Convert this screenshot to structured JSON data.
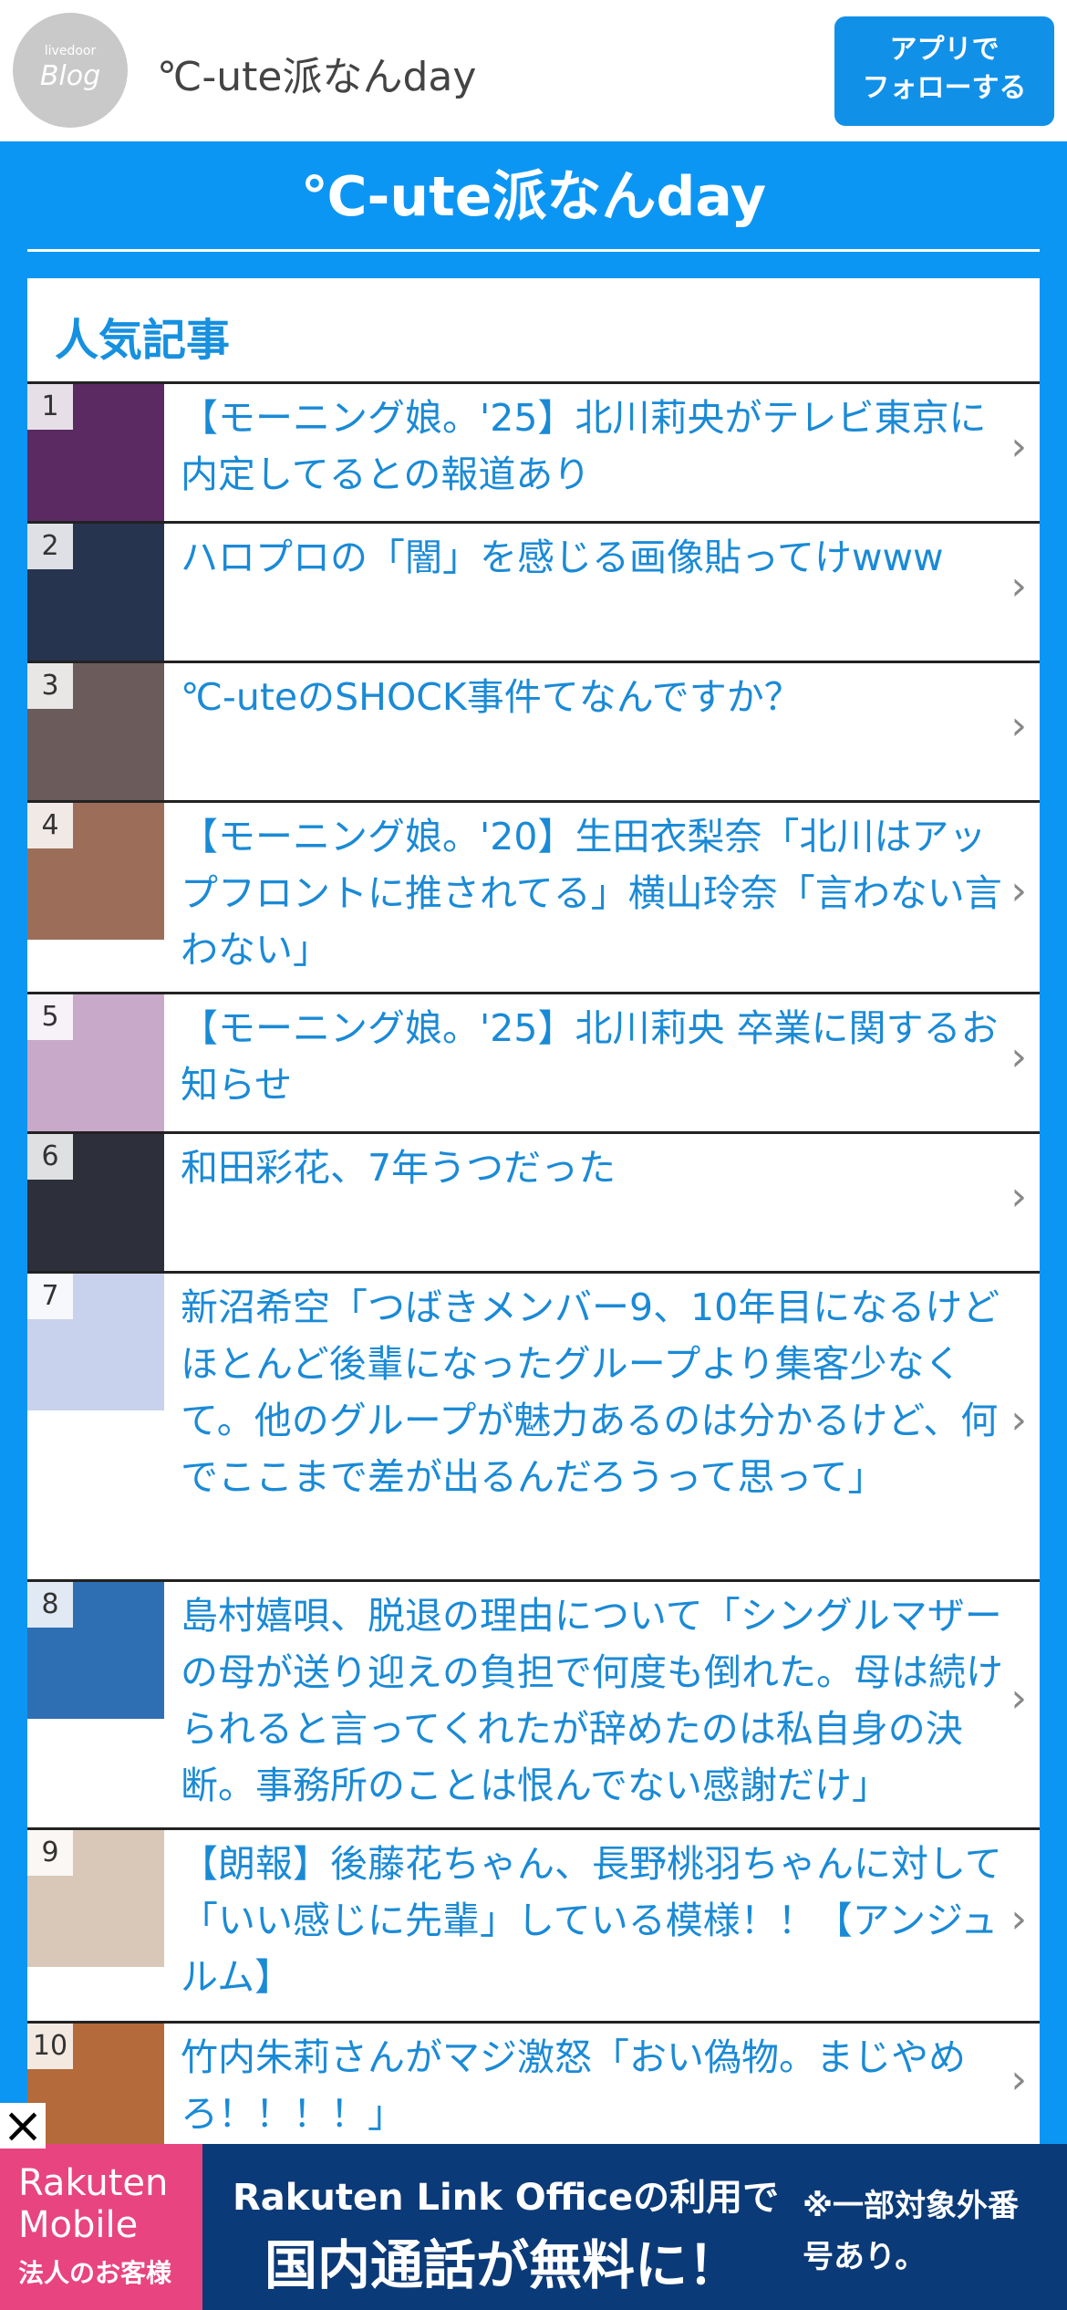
{
  "header": {
    "logo_small": "livedoor",
    "logo_big": "Blog",
    "site_name": "℃-ute派なんday",
    "follow_line1": "アプリで",
    "follow_line2": "フォローする"
  },
  "blog": {
    "title": "℃-ute派なんday",
    "section_title": "人気記事"
  },
  "ranking": [
    {
      "rank": "1",
      "title": "【モーニング娘。'25】北川莉央がテレビ東京に内定してるとの報道あり",
      "thumb_color": "#5b2a63"
    },
    {
      "rank": "2",
      "title": "ハロプロの「闇」を感じる画像貼ってけwww",
      "thumb_color": "#27344f"
    },
    {
      "rank": "3",
      "title": "℃-uteのSHOCK事件てなんですか？",
      "thumb_color": "#6b5b5b"
    },
    {
      "rank": "4",
      "title": "【モーニング娘。'20】生田衣梨奈「北川はアップフロントに推されてる」横山玲奈「言わない言わない」",
      "thumb_color": "#9c6e59"
    },
    {
      "rank": "5",
      "title": "【モーニング娘。'25】北川莉央 卒業に関するお知らせ",
      "thumb_color": "#c9a9c9"
    },
    {
      "rank": "6",
      "title": "和田彩花、7年うつだった",
      "thumb_color": "#2d2f3a"
    },
    {
      "rank": "7",
      "title": "新沼希空「つばきメンバー9、10年目になるけどほとんど後輩になったグループより集客少なくて。他のグループが魅力あるのは分かるけど、何でここまで差が出るんだろうって思って」",
      "thumb_color": "#c8d2ec"
    },
    {
      "rank": "8",
      "title": "島村嬉唄、脱退の理由について「シングルマザーの母が送り迎えの負担で何度も倒れた。母は続けられると言ってくれたが辞めたのは私自身の決断。事務所のことは恨んでない感謝だけ」",
      "thumb_color": "#2e6fb4"
    },
    {
      "rank": "9",
      "title": "【朗報】後藤花ちゃん、長野桃羽ちゃんに対して「いい感じに先輩」している模様！！【アンジュルム】",
      "thumb_color": "#d9c7b7"
    },
    {
      "rank": "10",
      "title": "竹内朱莉さんがマジ激怒「おい偽物。まじやめろ！！！！」",
      "thumb_color": "#b46a3a"
    }
  ],
  "ad": {
    "logo_line1": "Rakuten",
    "logo_line2": "Mobile",
    "logo_line3": "法人のお客様",
    "main_line1": "Rakuten Link Officeの利用で",
    "main_line2": "国内通話が無料に！",
    "note_line1": "※一部対象外番",
    "note_line2": "号あり。"
  },
  "colors": {
    "accent": "#0c96f4",
    "link": "#1a8ad6",
    "follow_button": "#1190e8"
  },
  "icons": {
    "chevron": "chevron-right-icon",
    "close": "close-icon"
  }
}
